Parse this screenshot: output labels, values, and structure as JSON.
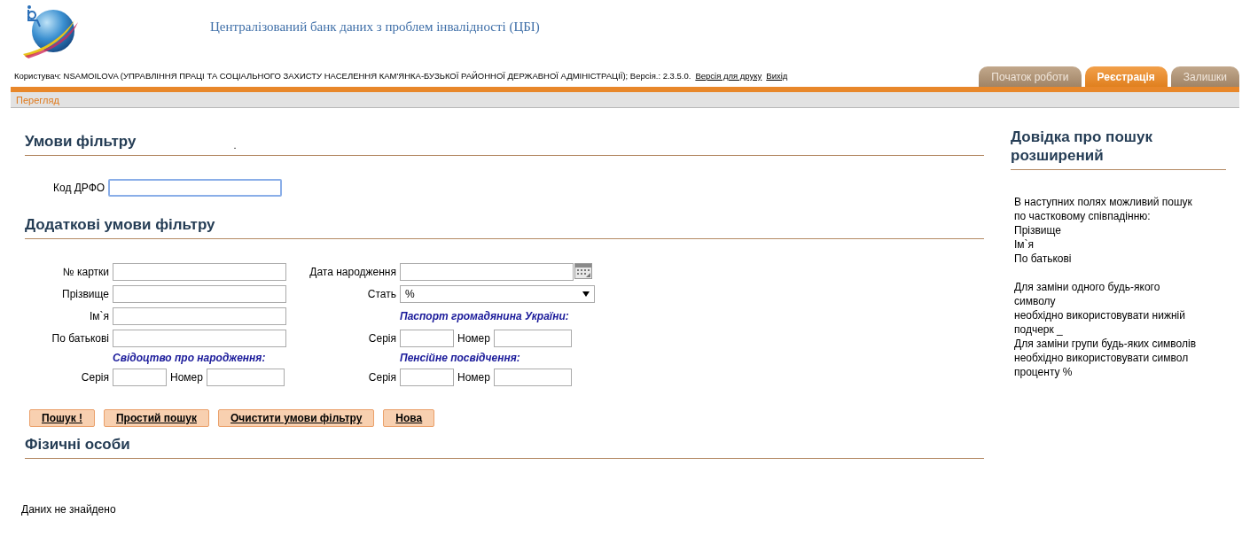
{
  "header": {
    "title": "Централізований банк даних з проблем інвалідності (ЦБІ)",
    "user_info": "Користувач: NSAMOILOVA (УПРАВЛІННЯ ПРАЦІ ТА СОЦІАЛЬНОГО ЗАХИСТУ НАСЕЛЕННЯ КАМ'ЯНКА-БУЗЬКОЇ РАЙОННОЇ ДЕРЖАВНОЇ АДМІНІСТРАЦІЇ); Версія.: 2.3.5.0.",
    "links": [
      "Версія для друку",
      "Вихід"
    ]
  },
  "tabs": [
    {
      "label": "Початок роботи",
      "selected": false
    },
    {
      "label": "Реєстрація",
      "selected": true
    },
    {
      "label": "Залишки",
      "selected": false
    }
  ],
  "subnav": "Перегляд",
  "filter": {
    "heading": "Умови фільтру",
    "mark": ".",
    "code_label": "Код ДРФО",
    "code_focused": true
  },
  "extra": {
    "heading": "Додаткові умови фільтру",
    "card_label": "№ картки",
    "birth_label": "Дата народження",
    "surname_label": "Прізвище",
    "sex_label": "Стать",
    "sex_value": "%",
    "name_label": "Ім`я",
    "passport_heading": "Паспорт громадянина України:",
    "patronymic_label": "По батькові",
    "series_label_1": "Серія",
    "number_label_1": "Номер",
    "birth_cert_heading": "Свідоцтво про народження:",
    "pension_heading": "Пенсійне посвідчення:",
    "series_label_2": "Серія",
    "number_label_2": "Номер",
    "series_label_3": "Серія",
    "number_label_3": "Номер"
  },
  "buttons": [
    "Пошук !",
    "Простий пошук",
    "Очистити умови фільтру",
    "Нова"
  ],
  "results": {
    "heading": "Фізичні особи",
    "empty": "Даних не знайдено"
  },
  "help": {
    "heading": "Довідка про пошук розширений",
    "paragraphs": [
      [
        "В наступних полях можливий пошук",
        "по частковому співпадінню:",
        "Прізвище",
        "Ім`я",
        "По батькові"
      ],
      [
        "Для заміни одного будь-якого",
        "символу",
        "необхідно використовувати нижній",
        "подчерк _",
        "Для заміни групи будь-яких символів",
        "необхідно використовувати символ",
        "проценту %"
      ]
    ]
  }
}
